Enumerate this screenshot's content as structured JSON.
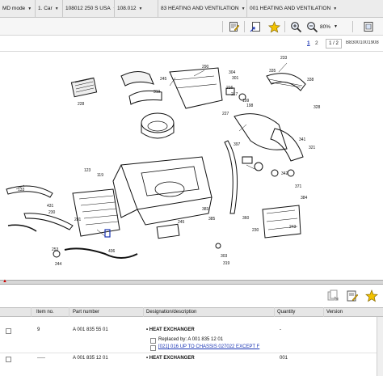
{
  "nav": {
    "crumbs": [
      {
        "label": "MD mode"
      },
      {
        "label": "1. Car"
      },
      {
        "label": "108012 250 S USA"
      },
      {
        "label": "108.012"
      },
      {
        "label": "83 HEATING AND VENTILATION"
      },
      {
        "label": "001 HEATING AND VENTILATION"
      }
    ]
  },
  "toolbar": {
    "icons": [
      "edit-note-icon",
      "page-link-icon",
      "favorite-star-icon",
      "zoom-in-icon",
      "zoom-out-icon"
    ],
    "zoom_value": "80%",
    "accent_color": "#e8b400"
  },
  "pagebar": {
    "page1": "1",
    "page2": "2",
    "page_count": "1 / 2",
    "document_id": "B83001001908"
  },
  "drawing": {
    "callouts": [
      "233",
      "290",
      "304",
      "301",
      "335",
      "338",
      "216",
      "217",
      "245",
      "319",
      "199",
      "198",
      "227",
      "228",
      "328",
      "341",
      "321",
      "123",
      "119",
      "133",
      "431",
      "230",
      "281",
      "383",
      "385",
      "436",
      "244",
      "253",
      "397",
      "342",
      "371",
      "384",
      "360",
      "230",
      "243",
      "303",
      "319",
      "245"
    ]
  },
  "parts_toolbar": {
    "icons": [
      "copy-to-list-icon",
      "edit-note-icon",
      "favorite-star-icon"
    ]
  },
  "table": {
    "headers": {
      "item": "Item no.",
      "part": "Part number",
      "designation": "Designation/description",
      "quantity": "Quantity",
      "version": "Version"
    },
    "rows": [
      {
        "item": "9",
        "part": "A 001 835 55 01",
        "designation": "HEAT EXCHANGER",
        "quantity": "-",
        "replaced_label": "Replaced by: A 001 835 12 01",
        "note": "[021] 016 UP TO CHASSIS 027022 EXCEPT F"
      },
      {
        "item": "-----",
        "part": "A 001 835 12 01",
        "designation": "HEAT EXCHANGER",
        "quantity": "001"
      }
    ]
  }
}
